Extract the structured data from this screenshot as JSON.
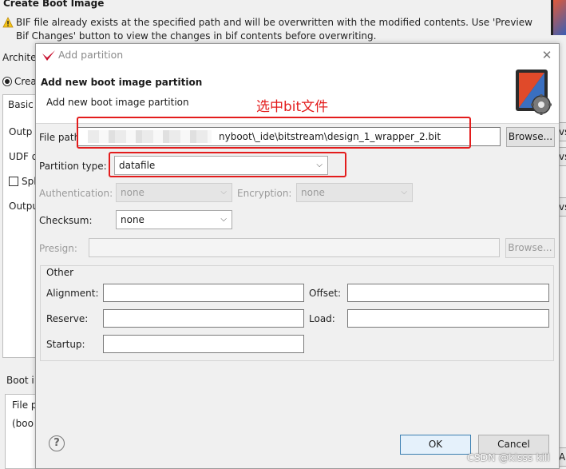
{
  "background": {
    "title": "Create Boot Image",
    "warning": "BIF file already exists at the specified path and will be overwritten with the modified contents. Use 'Preview Bif Changes' button to view the changes in bif contents before overwriting.",
    "labels": {
      "architecture": "Archite",
      "create": "Crea",
      "basic": "Basic",
      "output": "Outp",
      "udf": "UDF d",
      "split": "Spl",
      "output2": "Outpu",
      "boot_image": "Boot i",
      "file": "File p",
      "boot": "(boo"
    },
    "right_buttons": [
      "vs",
      "vs",
      "vs",
      "A"
    ]
  },
  "dialog": {
    "window_title": "Add partition",
    "header_title": "Add new boot image partition",
    "header_subtitle": "Add new boot image partition",
    "annotation": "选中bit文件",
    "file_path": {
      "label": "File path:",
      "value": "nyboot\\_ide\\bitstream\\design_1_wrapper_2.bit",
      "browse": "Browse..."
    },
    "partition_type": {
      "label": "Partition type:",
      "value": "datafile"
    },
    "authentication": {
      "label": "Authentication:",
      "value": "none"
    },
    "encryption": {
      "label": "Encryption:",
      "value": "none"
    },
    "checksum": {
      "label": "Checksum:",
      "value": "none"
    },
    "presign": {
      "label": "Presign:",
      "browse": "Browse..."
    },
    "other": {
      "legend": "Other",
      "alignment": "Alignment:",
      "offset": "Offset:",
      "reserve": "Reserve:",
      "load": "Load:",
      "startup": "Startup:"
    },
    "buttons": {
      "help": "?",
      "ok": "OK",
      "cancel": "Cancel"
    }
  },
  "watermark": "CSDN @kisss kill",
  "colors": {
    "annotation_red": "#e31c1c",
    "ok_border": "#3c7fb1"
  }
}
